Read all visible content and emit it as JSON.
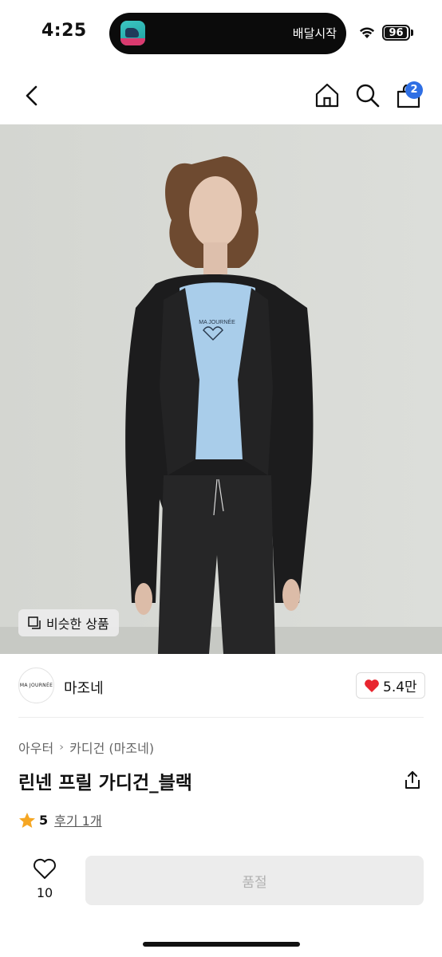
{
  "status_bar": {
    "time": "4:25",
    "live_activity_text": "배달시작",
    "battery_level": "96",
    "battery_percent": 96
  },
  "nav": {
    "cart_count": "2",
    "icons": [
      "back-icon",
      "home-icon",
      "search-icon",
      "cart-icon"
    ]
  },
  "hero": {
    "print_line": "MA JOURNÉE",
    "similar_products_label": "비슷한 상품"
  },
  "brand": {
    "logo_text": "MA JOURNÉE",
    "name": "마조네",
    "likes": "5.4만"
  },
  "product": {
    "breadcrumb": [
      "아우터",
      "카디건 (마조네)"
    ],
    "title": "린넨 프릴 가디건_블랙",
    "rating": "5",
    "reviews_label": "후기 1개"
  },
  "bottom_bar": {
    "wish_count": "10",
    "buy_button_label": "품절"
  },
  "colors": {
    "accent_blue": "#2f6fe4",
    "heart_red": "#e8262f",
    "star_orange": "#f5a623",
    "disabled_bg": "#ececec",
    "disabled_text": "#b0b0b0"
  }
}
